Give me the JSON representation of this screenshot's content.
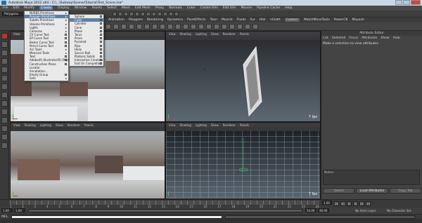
{
  "window": {
    "title": "Autodesk Maya 2012 x64 - C:\\...\\Subway\\ScenesTutorial\\Test_Scene.ma*"
  },
  "menubar": [
    "File",
    "Edit",
    "Modify",
    "Create",
    "Display",
    "Window",
    "Assets",
    "Select",
    "Mesh",
    "Edit Mesh",
    "Proxy",
    "Normals",
    "Color",
    "Create UVs",
    "Edit UVs",
    "Muscle",
    "Pipeline Cache",
    "Help"
  ],
  "menubar_active": "Create",
  "status": {
    "mode": "Polygons"
  },
  "shelf_tabs": [
    "Animation",
    "Polygons",
    "Rendering",
    "Dynamics",
    "PaintEffects",
    "Toon",
    "Muscle",
    "Fluids",
    "Fur",
    "Hair",
    "nCloth",
    "Custom",
    "MatchMoveTools",
    "PowerCK",
    "Mayash"
  ],
  "shelf_selected": "Custom",
  "create_menu": {
    "items": [
      {
        "label": "NURBS Primitives",
        "submenu": true
      },
      {
        "label": "Polygon Primitives",
        "submenu": true,
        "highlighted": true
      },
      {
        "label": "Subdiv Primitives",
        "submenu": true
      },
      {
        "label": "Volume Primitives",
        "submenu": true
      },
      {
        "label": "Lights",
        "submenu": true
      },
      {
        "label": "Cameras",
        "submenu": true
      },
      {
        "label": "CV Curve Tool",
        "option": true
      },
      {
        "label": "EP Curve Tool",
        "option": true
      },
      {
        "label": "Bezier Curve Tool",
        "option": true
      },
      {
        "label": "Pencil Curve Tool",
        "option": true
      },
      {
        "label": "Arc Tools",
        "submenu": true
      },
      {
        "label": "Measure Tools",
        "submenu": true
      },
      {
        "label": "Text",
        "option": true
      },
      {
        "label": "Adobe(R) Illustrator(R) Object...",
        "option": true
      },
      {
        "label": "Construction Plane",
        "option": true
      },
      {
        "label": "Locator"
      },
      {
        "label": "Annotation..."
      },
      {
        "label": "Empty Group",
        "option": true
      },
      {
        "label": "Sets",
        "submenu": true
      }
    ]
  },
  "polygon_submenu": {
    "items": [
      {
        "label": "Sphere",
        "option": true
      },
      {
        "label": "Cube",
        "option": true,
        "highlighted": true
      },
      {
        "label": "Cylinder",
        "option": true
      },
      {
        "label": "Cone",
        "option": true
      },
      {
        "label": "Plane",
        "option": true
      },
      {
        "label": "Torus",
        "option": true
      },
      {
        "label": "Prism",
        "option": true
      },
      {
        "label": "Pyramid",
        "option": true
      },
      {
        "label": "Pipe",
        "option": true
      },
      {
        "label": "Helix",
        "option": true
      },
      {
        "label": "Soccer Ball",
        "option": true
      },
      {
        "label": "Platonic Solids",
        "option": true
      },
      {
        "label": "Interactive Creation",
        "checkbox": true
      },
      {
        "label": "Exit On Completion",
        "checkbox": true
      }
    ]
  },
  "viewport_menu": [
    "View",
    "Shading",
    "Lighting",
    "Show",
    "Renderer",
    "Panels"
  ],
  "viewports": [
    {
      "name": "top-left"
    },
    {
      "name": "top-right",
      "fps": "7 fps"
    },
    {
      "name": "bottom-left"
    },
    {
      "name": "bottom-right",
      "fps": "7 fps"
    }
  ],
  "attribute_editor": {
    "title": "Attribute Editor",
    "menu": [
      "List",
      "Selected",
      "Focus",
      "Attributes",
      "Show",
      "Help"
    ],
    "message": "Make a selection to view attributes",
    "notes_label": "Notes:",
    "buttons": [
      "Select",
      "Load Attributes",
      "Copy Tab"
    ]
  },
  "timeline": {
    "ticks": [
      "1",
      "2",
      "3",
      "4",
      "5",
      "6",
      "7",
      "8",
      "9",
      "10",
      "11",
      "12",
      "13",
      "14",
      "15",
      "16",
      "17",
      "18",
      "19",
      "20",
      "21",
      "22",
      "23",
      "24"
    ],
    "current_frame": "1.00",
    "playback": [
      "|<",
      "<|",
      "<",
      ">",
      "|>",
      ">|"
    ]
  },
  "range": {
    "start": "1.00",
    "start_inner": "1.00",
    "end_inner": "24.00",
    "end": "48.00",
    "anim_layer": "No Anim Layer",
    "char_set": "No Character Set"
  },
  "command_line": {
    "label": "MEL"
  }
}
